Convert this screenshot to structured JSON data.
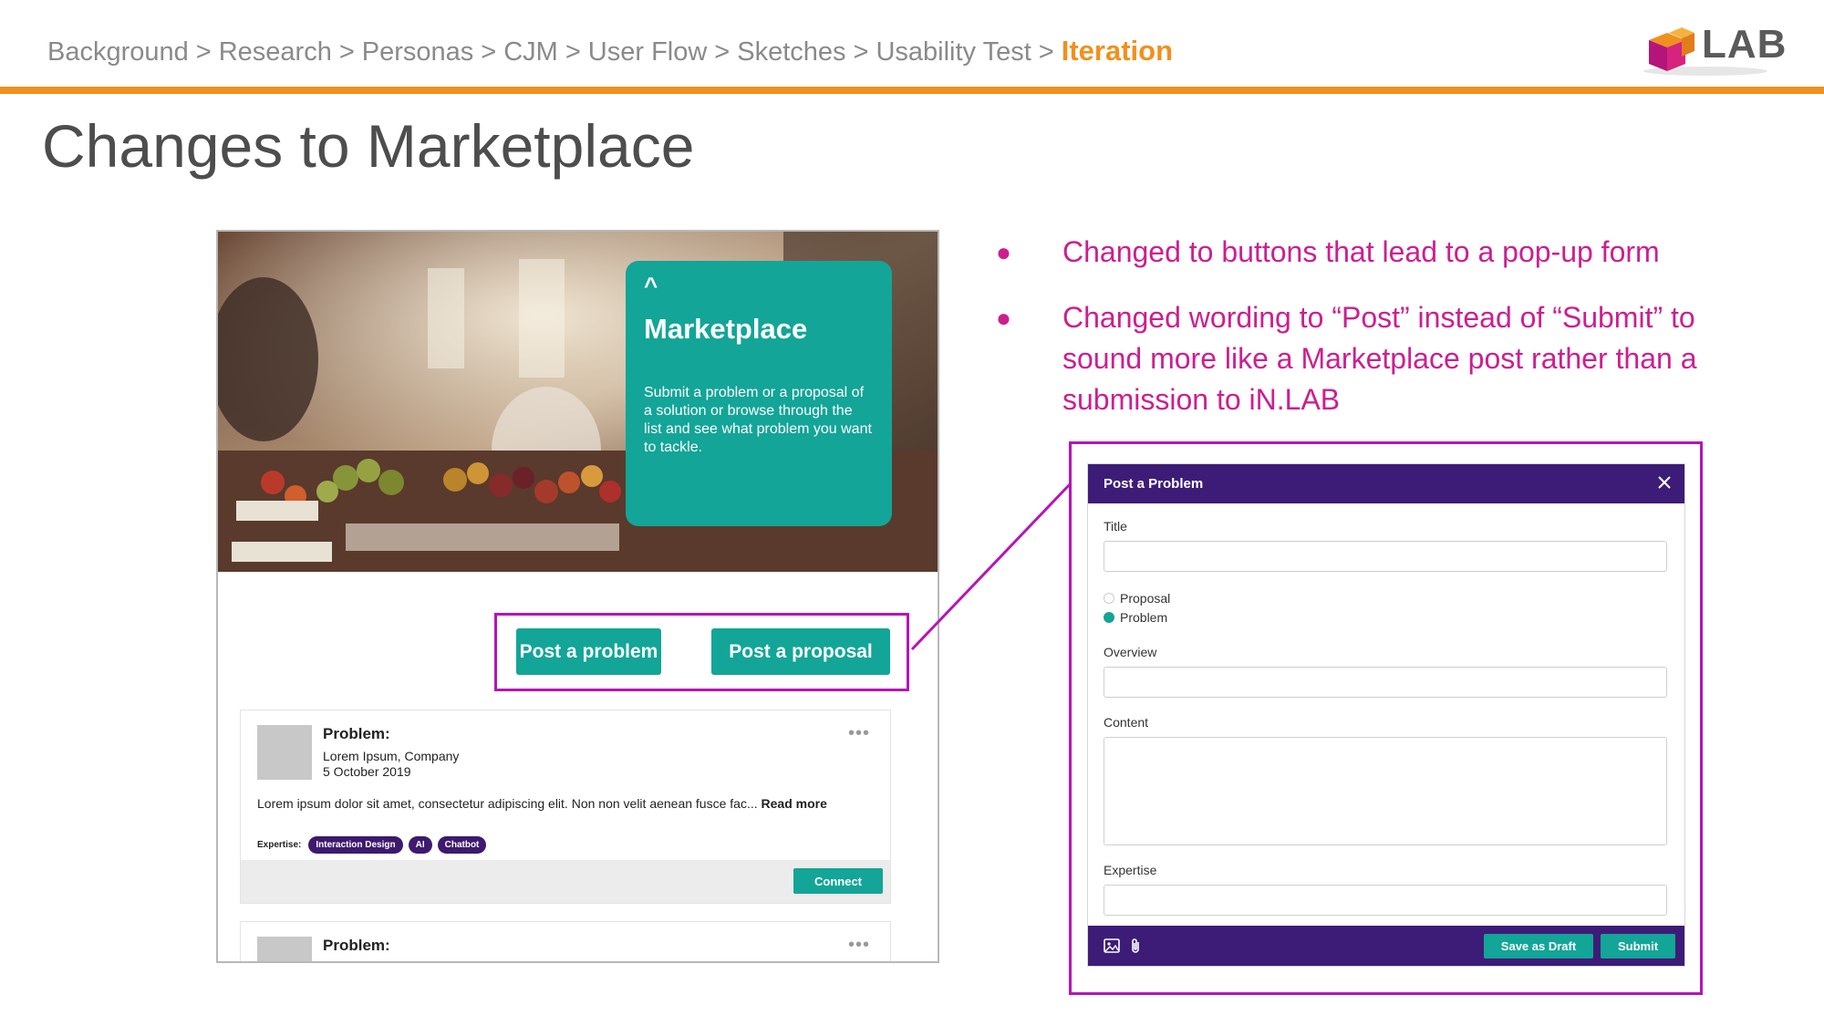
{
  "breadcrumb": {
    "items": [
      "Background",
      "Research",
      "Personas",
      "CJM",
      "User Flow",
      "Sketches",
      "Usability Test"
    ],
    "separator": ">",
    "current": "Iteration"
  },
  "logo": {
    "text": "LAB",
    "icon": "cube-logo-icon"
  },
  "slide_title": "Changes to Marketplace",
  "marketplace": {
    "caret": "^",
    "title": "Marketplace",
    "description": "Submit a problem or a proposal of a solution or browse through the list and see what problem you want to tackle.",
    "post_problem_label": "Post a problem",
    "post_proposal_label": "Post a proposal",
    "posts": [
      {
        "type": "Problem:",
        "author": "Lorem Ipsum, Company",
        "date": "5 October 2019",
        "body": "Lorem ipsum dolor sit amet, consectetur adipiscing elit. Non non velit aenean fusce fac...",
        "read_more": "Read more",
        "expertise_label": "Expertise:",
        "tags": [
          "Interaction Design",
          "AI",
          "Chatbot"
        ],
        "connect_label": "Connect",
        "menu": "•••"
      },
      {
        "type": "Problem:",
        "menu": "•••"
      }
    ]
  },
  "bullets": [
    "Changed to buttons that lead to a pop-up form",
    "Changed wording to “Post” instead of “Submit” to sound more like a Marketplace post rather than a submission to iN.LAB"
  ],
  "bullet_glyph": "●",
  "form": {
    "title": "Post a Problem",
    "fields": {
      "title_label": "Title",
      "overview_label": "Overview",
      "content_label": "Content",
      "expertise_label": "Expertise"
    },
    "radio_options": [
      "Proposal",
      "Problem"
    ],
    "selected_option": "Problem",
    "save_draft_label": "Save as Draft",
    "submit_label": "Submit"
  },
  "colors": {
    "accent_orange": "#f0901e",
    "teal": "#13a597",
    "purple": "#3d1c78",
    "highlight_magenta": "#b515b8",
    "bullet_pink": "#cc1f8f"
  }
}
